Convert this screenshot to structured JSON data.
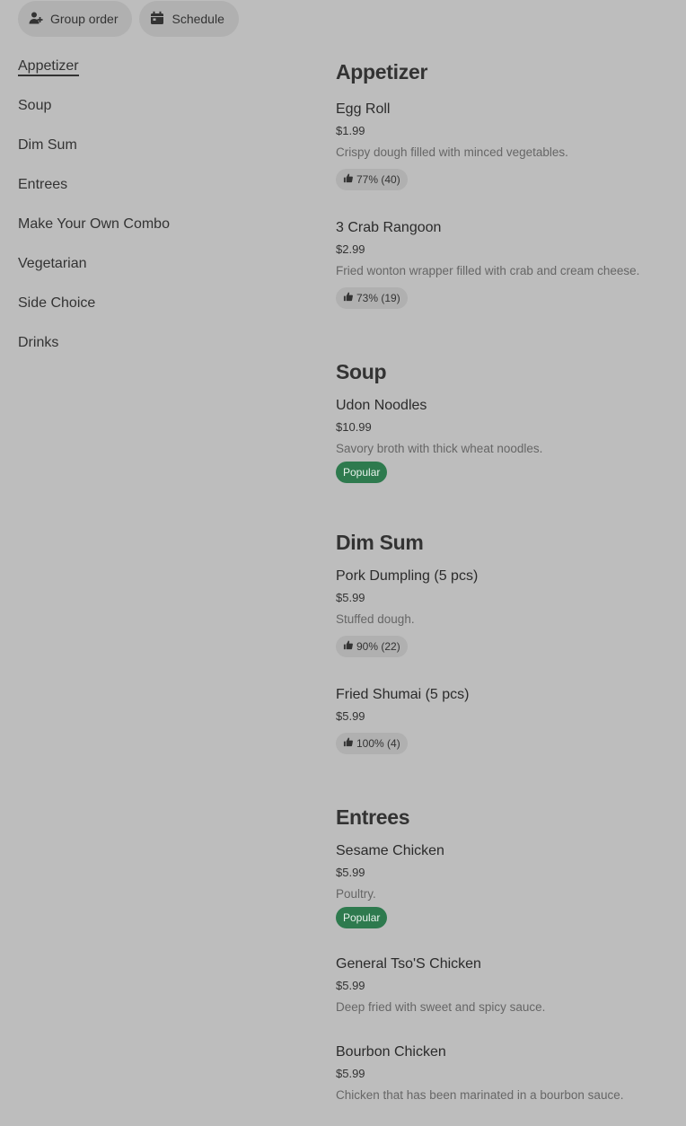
{
  "top_actions": {
    "group_order": "Group order",
    "schedule": "Schedule"
  },
  "sidebar": {
    "items": [
      {
        "label": "Appetizer"
      },
      {
        "label": "Soup"
      },
      {
        "label": "Dim Sum"
      },
      {
        "label": "Entrees"
      },
      {
        "label": "Make Your Own Combo"
      },
      {
        "label": "Vegetarian"
      },
      {
        "label": "Side Choice"
      },
      {
        "label": "Drinks"
      }
    ]
  },
  "menu": {
    "appetizer": {
      "title": "Appetizer",
      "items": [
        {
          "name": "Egg Roll",
          "price": "$1.99",
          "desc": "Crispy dough filled with minced vegetables.",
          "rating": "77% (40)"
        },
        {
          "name": "3 Crab Rangoon",
          "price": "$2.99",
          "desc": "Fried wonton wrapper filled with crab and cream cheese.",
          "rating": "73% (19)"
        }
      ]
    },
    "soup": {
      "title": "Soup",
      "items": [
        {
          "name": "Udon Noodles",
          "price": "$10.99",
          "desc": "Savory broth with thick wheat noodles.",
          "badge": "Popular"
        }
      ]
    },
    "dimsum": {
      "title": "Dim Sum",
      "items": [
        {
          "name": "Pork Dumpling (5 pcs)",
          "price": "$5.99",
          "desc": "Stuffed dough.",
          "rating": "90% (22)"
        },
        {
          "name": "Fried Shumai (5 pcs)",
          "price": "$5.99",
          "rating": "100% (4)"
        }
      ]
    },
    "entrees": {
      "title": "Entrees",
      "items": [
        {
          "name": "Sesame Chicken",
          "price": "$5.99",
          "desc": "Poultry.",
          "badge": "Popular"
        },
        {
          "name": "General Tso'S Chicken",
          "price": "$5.99",
          "desc": "Deep fried with sweet and spicy sauce."
        },
        {
          "name": "Bourbon Chicken",
          "price": "$5.99",
          "desc": "Chicken that has been marinated in a bourbon sauce."
        }
      ]
    }
  },
  "colors": {
    "background": "#bdbdbd",
    "pill": "#b0b0b0",
    "popular_badge": "#2e7a4e"
  },
  "icons": {
    "group_order": "person-add-icon",
    "schedule": "calendar-icon",
    "rating": "thumbs-up-icon"
  }
}
